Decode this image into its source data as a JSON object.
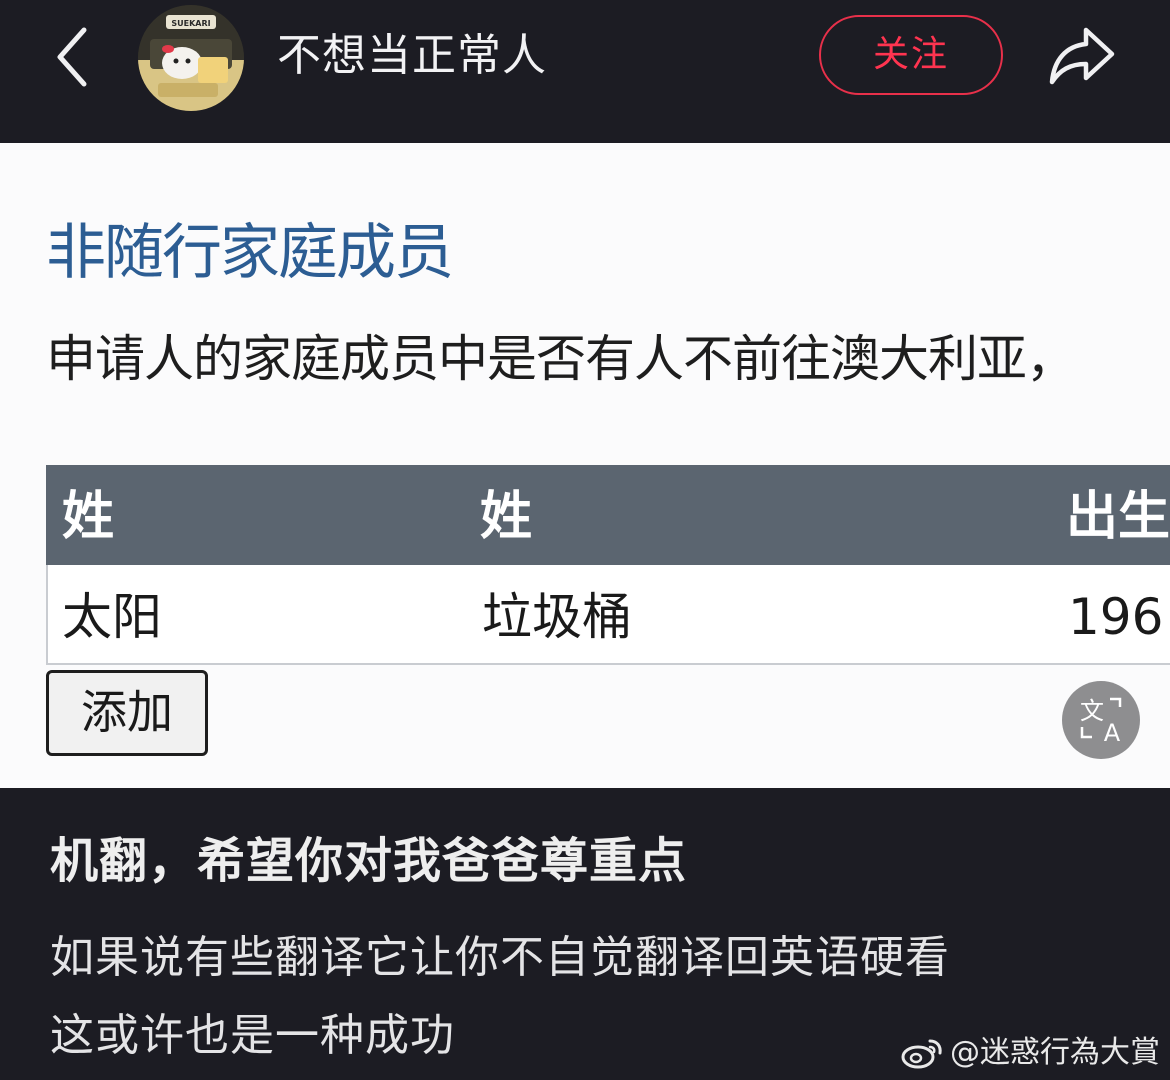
{
  "header": {
    "username": "不想当正常人",
    "follow_label": "关注",
    "avatar_text": "SUEKARI"
  },
  "screenshot": {
    "title": "非随行家庭成员",
    "question": "申请人的家庭成员中是否有人不前往澳大利亚，",
    "table": {
      "columns": [
        "姓",
        "姓",
        "出生"
      ],
      "rows": [
        [
          "太阳",
          "垃圾桶",
          "196"
        ]
      ]
    },
    "add_label": "添加",
    "translate_icon": "translate-icon"
  },
  "caption": {
    "title": "机翻，希望你对我爸爸尊重点",
    "line1": "如果说有些翻译它让你不自觉翻译回英语硬看",
    "line2": "这或许也是一种成功"
  },
  "watermark": {
    "text": "@迷惑行為大賞"
  },
  "colors": {
    "accent_follow": "#ff3450",
    "title_blue": "#2c5d93",
    "table_header": "#5b6570",
    "dark_bg": "#1c1c23"
  }
}
